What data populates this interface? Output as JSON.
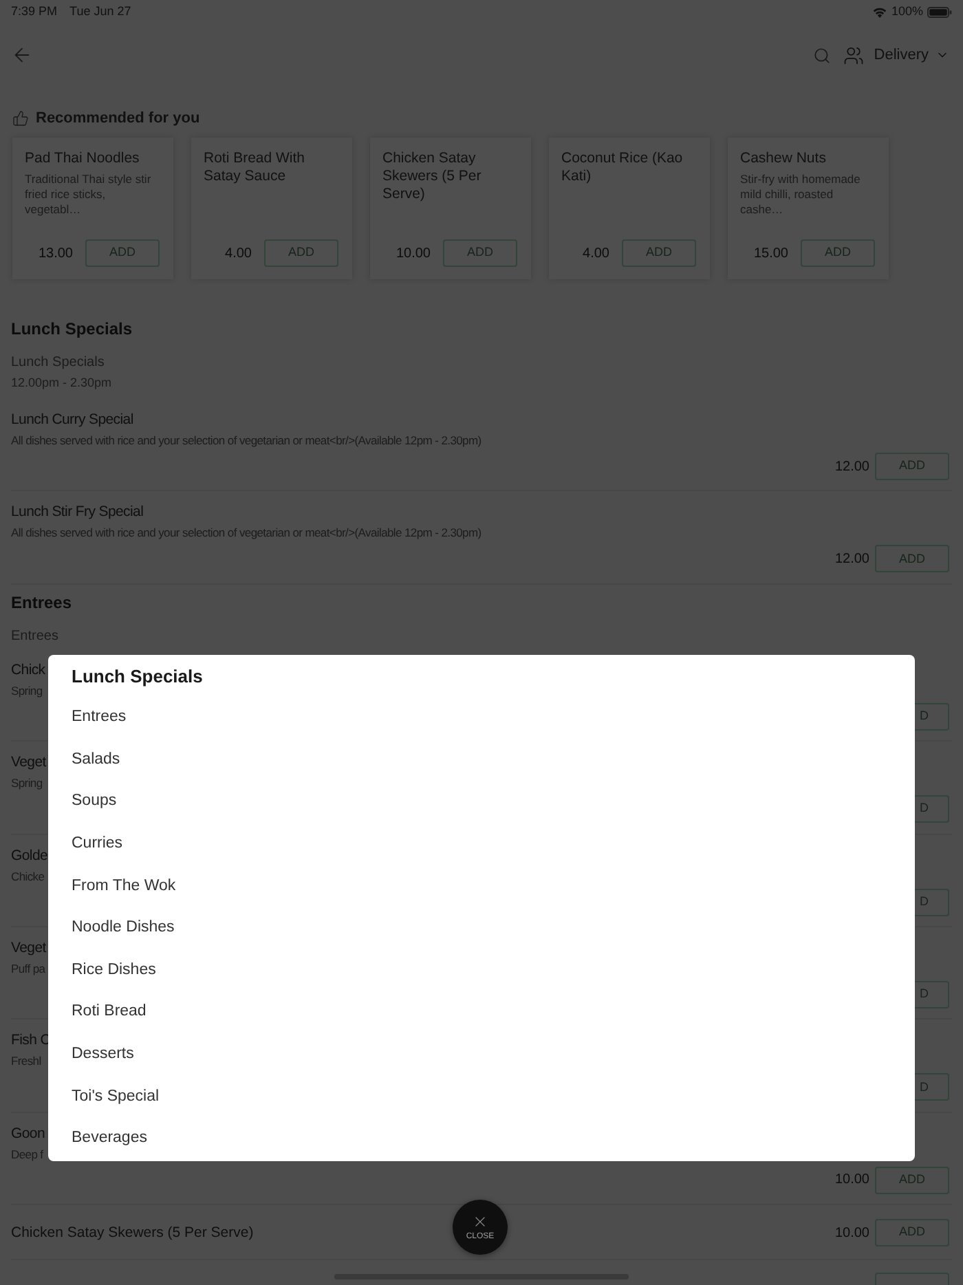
{
  "status_bar": {
    "time": "7:39 PM",
    "date": "Tue Jun 27",
    "battery": "100%"
  },
  "header": {
    "order_mode": "Delivery"
  },
  "recommended": {
    "title": "Recommended for you",
    "items": [
      {
        "name": "Pad Thai Noodles",
        "description": "Traditional Thai style stir fried rice sticks, vegetabl…",
        "price": "13.00",
        "button": "ADD"
      },
      {
        "name": "Roti Bread With Satay Sauce",
        "price": "4.00",
        "button": "ADD"
      },
      {
        "name": "Chicken Satay Skewers (5 Per Serve)",
        "price": "10.00",
        "button": "ADD"
      },
      {
        "name": "Coconut Rice (Kao Kati)",
        "price": "4.00",
        "button": "ADD"
      },
      {
        "name": "Cashew Nuts",
        "description": "Stir-fry with homemade mild chilli, roasted cashe…",
        "price": "15.00",
        "button": "ADD"
      }
    ]
  },
  "sections": [
    {
      "title": "Lunch Specials",
      "subtitle": "Lunch Specials",
      "hours": "12.00pm - 2.30pm",
      "items": [
        {
          "kind": "full",
          "name": "Lunch Curry Special",
          "description": "All dishes served with rice and your selection of vegetarian or meat<br/>(Available 12pm - 2.30pm)",
          "price": "12.00",
          "button": "ADD"
        },
        {
          "kind": "full",
          "name": "Lunch Stir Fry Special",
          "description": "All dishes served with rice and your selection of vegetarian or meat<br/>(Available 12pm - 2.30pm)",
          "price": "12.00",
          "button": "ADD"
        }
      ]
    },
    {
      "title": "Entrees",
      "subtitle": "Entrees",
      "items": [
        {
          "kind": "covered",
          "name": "Chick",
          "description": "Spring",
          "button": "D"
        },
        {
          "kind": "covered",
          "name": "Veget",
          "description": "Spring",
          "button": "D"
        },
        {
          "kind": "covered",
          "name": "Golde",
          "description": "Chicke",
          "button": "D"
        },
        {
          "kind": "covered",
          "name": "Veget",
          "description": "Puff pa",
          "button": "D"
        },
        {
          "kind": "covered",
          "name": "Fish C",
          "description": "Freshl",
          "button": "D"
        },
        {
          "kind": "full",
          "name": "Goon",
          "description": "Deep f",
          "price": "10.00",
          "button": "ADD"
        },
        {
          "kind": "inline",
          "name": "Chicken Satay Skewers (5 Per Serve)",
          "price": "10.00",
          "button": "ADD"
        },
        {
          "kind": "stub"
        }
      ]
    }
  ],
  "category_menu": {
    "items": [
      {
        "label": "Lunch Specials",
        "selected": true
      },
      {
        "label": "Entrees",
        "selected": false
      },
      {
        "label": "Salads",
        "selected": false
      },
      {
        "label": "Soups",
        "selected": false
      },
      {
        "label": "Curries",
        "selected": false
      },
      {
        "label": "From The Wok",
        "selected": false
      },
      {
        "label": "Noodle Dishes",
        "selected": false
      },
      {
        "label": "Rice Dishes",
        "selected": false
      },
      {
        "label": "Roti Bread",
        "selected": false
      },
      {
        "label": "Desserts",
        "selected": false
      },
      {
        "label": "Toi's Special",
        "selected": false
      },
      {
        "label": "Beverages",
        "selected": false
      }
    ]
  },
  "close_button": {
    "label": "CLOSE"
  }
}
